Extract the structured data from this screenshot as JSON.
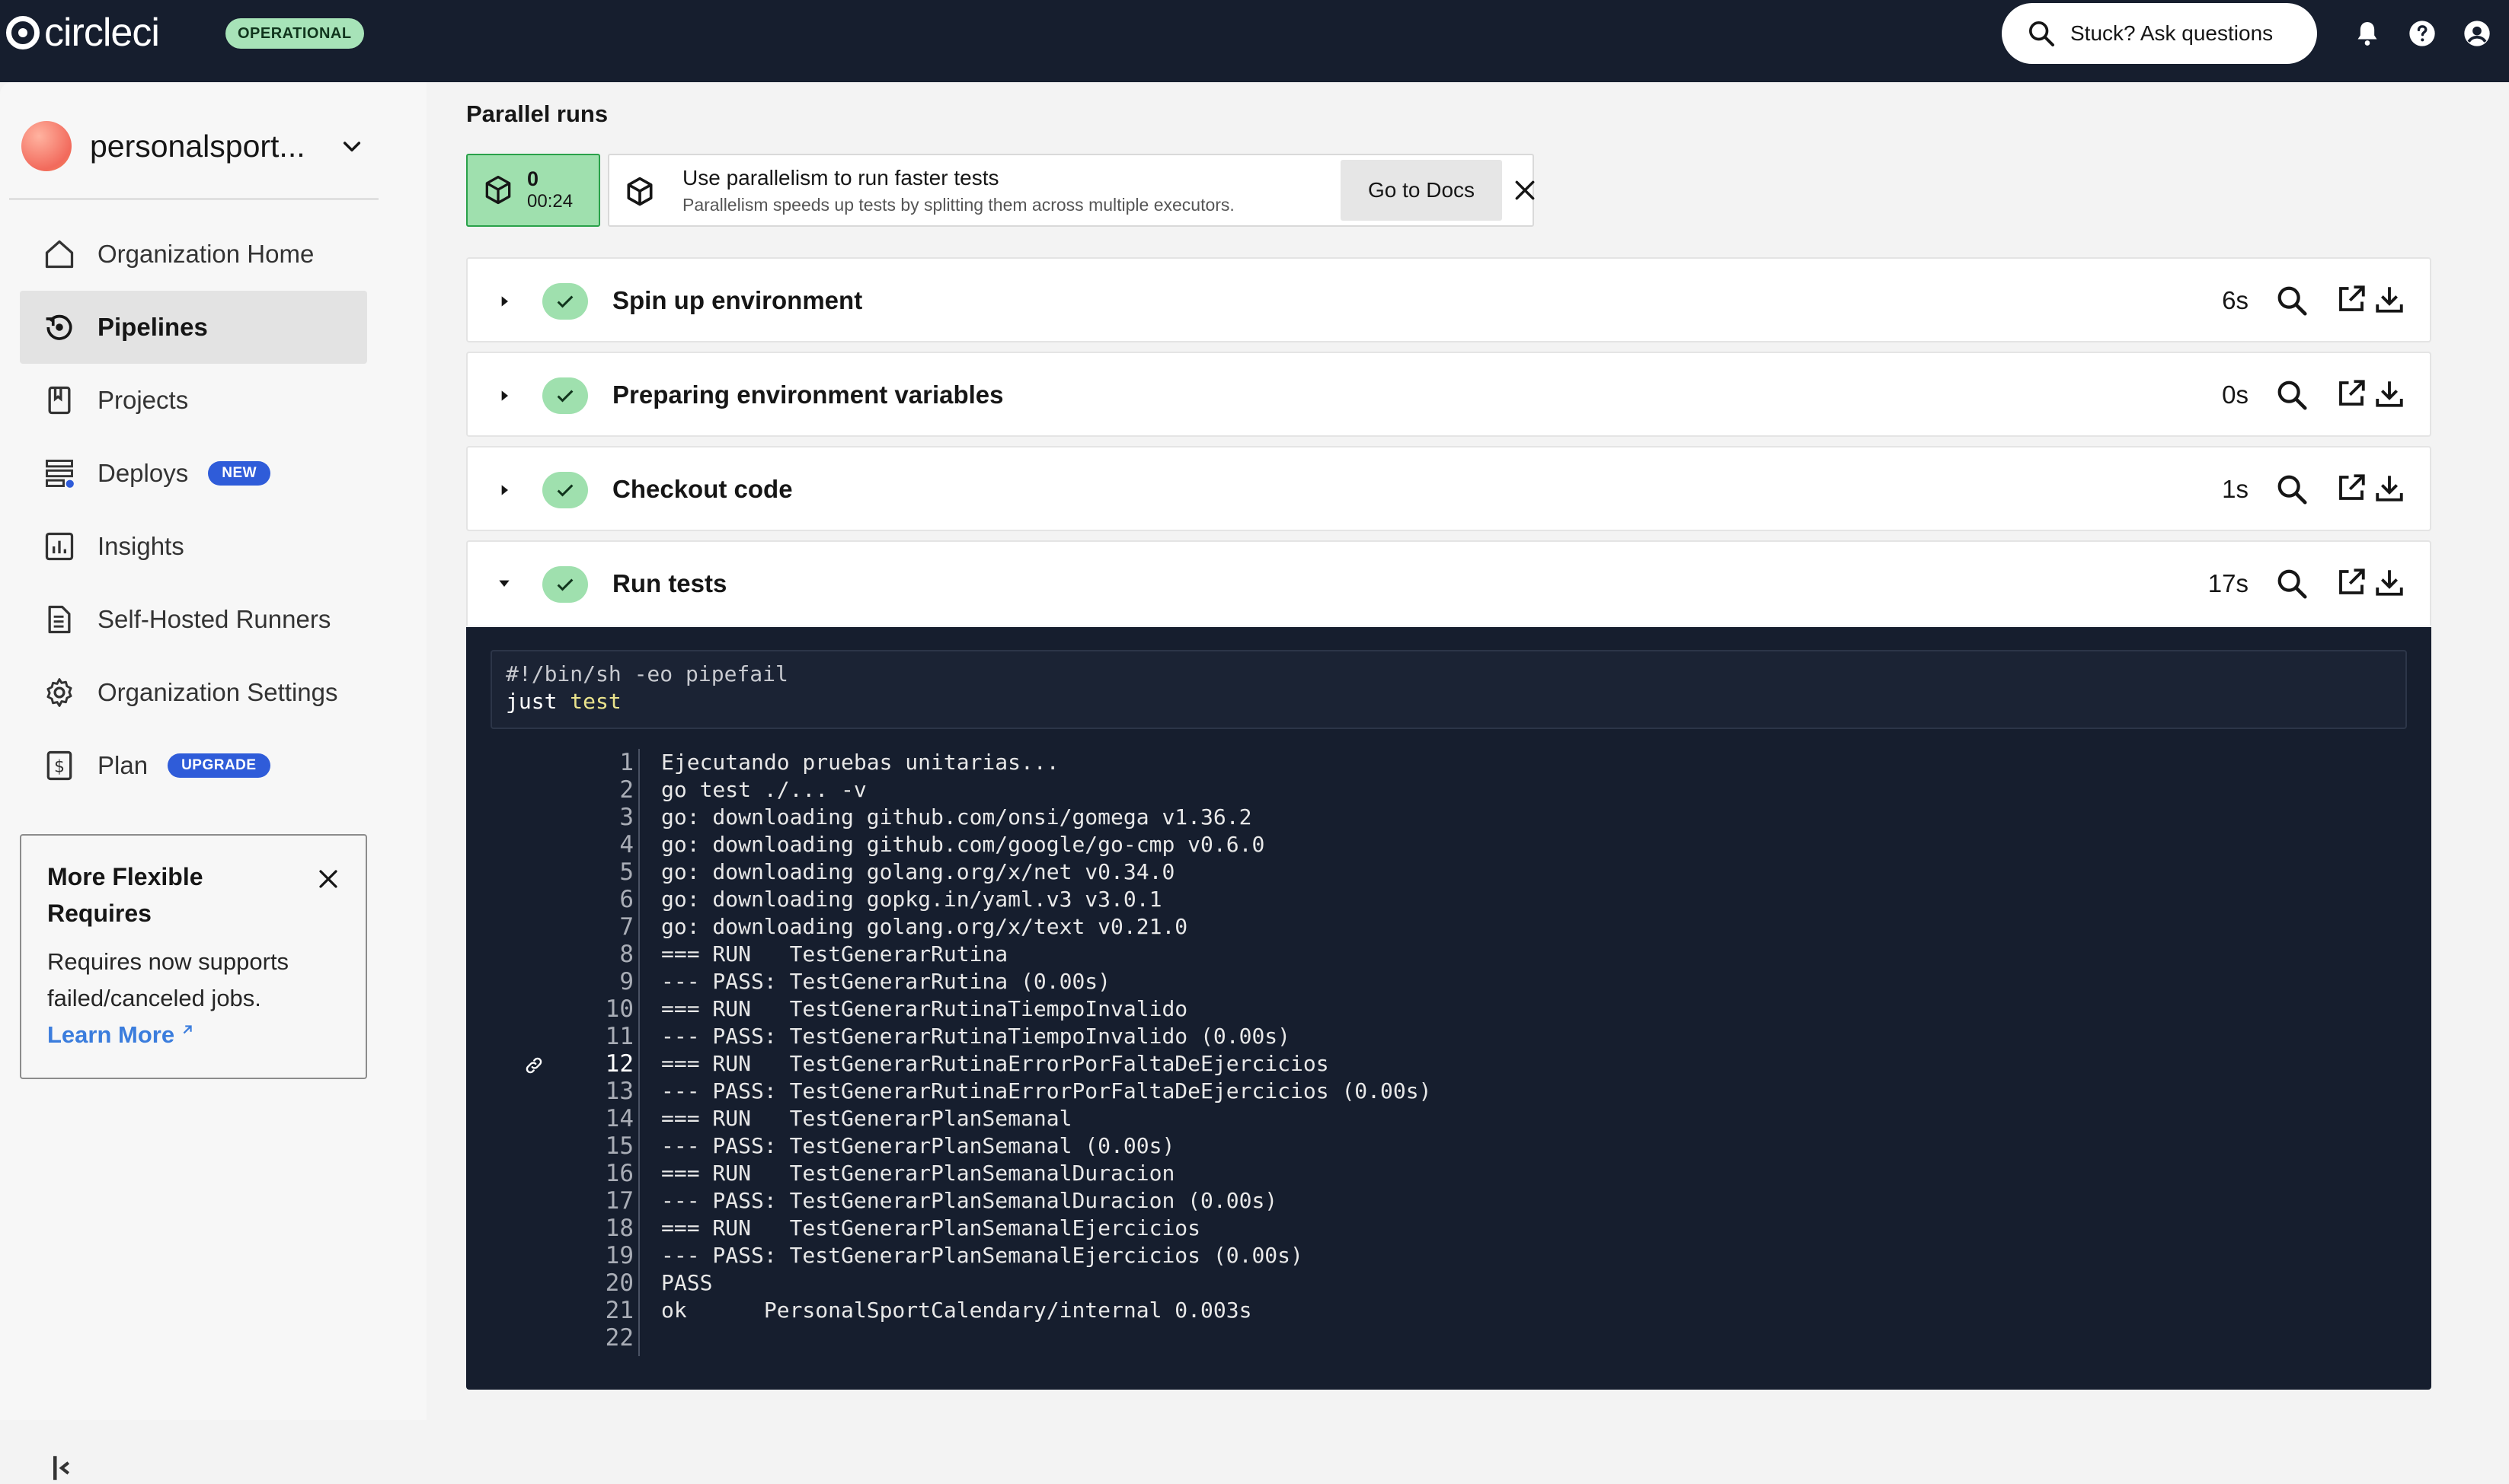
{
  "topbar": {
    "brand": "circleci",
    "status": "OPERATIONAL",
    "ask_label": "Stuck? Ask questions",
    "icons": [
      "search-icon",
      "bell-icon",
      "help-icon",
      "account-icon"
    ]
  },
  "sidebar": {
    "org_name": "personalsport...",
    "items": [
      {
        "label": "Organization Home",
        "icon": "home-icon",
        "active": false
      },
      {
        "label": "Pipelines",
        "icon": "pipelines-icon",
        "active": true
      },
      {
        "label": "Projects",
        "icon": "projects-icon",
        "active": false
      },
      {
        "label": "Deploys",
        "icon": "deploys-icon",
        "active": false,
        "badge": "NEW"
      },
      {
        "label": "Insights",
        "icon": "insights-icon",
        "active": false
      },
      {
        "label": "Self-Hosted Runners",
        "icon": "runners-icon",
        "active": false
      },
      {
        "label": "Organization Settings",
        "icon": "gear-icon",
        "active": false
      },
      {
        "label": "Plan",
        "icon": "plan-icon",
        "active": false,
        "badge": "UPGRADE"
      }
    ],
    "promo": {
      "title": "More Flexible Requires",
      "body": "Requires now supports failed/canceled jobs.",
      "link": "Learn More"
    }
  },
  "main": {
    "section_title": "Parallel runs",
    "run_chip": {
      "index": "0",
      "time": "00:24"
    },
    "tip": {
      "title": "Use parallelism to run faster tests",
      "subtitle": "Parallelism speeds up tests by splitting them across multiple executors.",
      "button": "Go to Docs"
    },
    "steps": [
      {
        "name": "Spin up environment",
        "duration": "6s",
        "expanded": false
      },
      {
        "name": "Preparing environment variables",
        "duration": "0s",
        "expanded": false
      },
      {
        "name": "Checkout code",
        "duration": "1s",
        "expanded": false
      },
      {
        "name": "Run tests",
        "duration": "17s",
        "expanded": true
      }
    ],
    "command": {
      "line1": "#!/bin/sh -eo pipefail",
      "line2_cmd": "just",
      "line2_arg": "test"
    },
    "log": [
      {
        "n": "1",
        "text": "Ejecutando pruebas unitarias..."
      },
      {
        "n": "2",
        "text": "go test ./... -v"
      },
      {
        "n": "3",
        "text": "go: downloading github.com/onsi/gomega v1.36.2"
      },
      {
        "n": "4",
        "text": "go: downloading github.com/google/go-cmp v0.6.0"
      },
      {
        "n": "5",
        "text": "go: downloading golang.org/x/net v0.34.0"
      },
      {
        "n": "6",
        "text": "go: downloading gopkg.in/yaml.v3 v3.0.1"
      },
      {
        "n": "7",
        "text": "go: downloading golang.org/x/text v0.21.0"
      },
      {
        "n": "8",
        "text": "=== RUN   TestGenerarRutina"
      },
      {
        "n": "9",
        "text": "--- PASS: TestGenerarRutina (0.00s)"
      },
      {
        "n": "10",
        "text": "=== RUN   TestGenerarRutinaTiempoInvalido"
      },
      {
        "n": "11",
        "text": "--- PASS: TestGenerarRutinaTiempoInvalido (0.00s)"
      },
      {
        "n": "12",
        "text": "=== RUN   TestGenerarRutinaErrorPorFaltaDeEjercicios",
        "highlight": true
      },
      {
        "n": "13",
        "text": "--- PASS: TestGenerarRutinaErrorPorFaltaDeEjercicios (0.00s)"
      },
      {
        "n": "14",
        "text": "=== RUN   TestGenerarPlanSemanal"
      },
      {
        "n": "15",
        "text": "--- PASS: TestGenerarPlanSemanal (0.00s)"
      },
      {
        "n": "16",
        "text": "=== RUN   TestGenerarPlanSemanalDuracion"
      },
      {
        "n": "17",
        "text": "--- PASS: TestGenerarPlanSemanalDuracion (0.00s)"
      },
      {
        "n": "18",
        "text": "=== RUN   TestGenerarPlanSemanalEjercicios"
      },
      {
        "n": "19",
        "text": "--- PASS: TestGenerarPlanSemanalEjercicios (0.00s)"
      },
      {
        "n": "20",
        "text": "PASS"
      },
      {
        "n": "21",
        "text": "ok      PersonalSportCalendary/internal 0.003s"
      },
      {
        "n": "22",
        "text": ""
      }
    ]
  },
  "colors": {
    "topbar": "#161e2e",
    "success": "#9fe0ae",
    "badge": "#2f5cd9",
    "link": "#3b7ddd"
  }
}
